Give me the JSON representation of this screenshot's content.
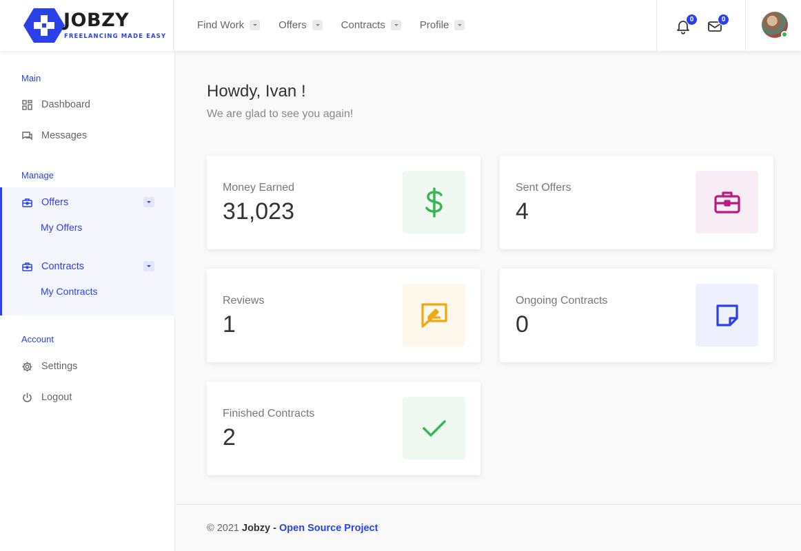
{
  "brand": {
    "name": "JOBZY",
    "tagline": "FREELANCING MADE EASY",
    "accent": "#2a41e8"
  },
  "nav": [
    {
      "label": "Find Work"
    },
    {
      "label": "Offers"
    },
    {
      "label": "Contracts"
    },
    {
      "label": "Profile"
    }
  ],
  "header": {
    "notifications_count": "0",
    "messages_count": "0"
  },
  "sidebar": {
    "main_title": "Main",
    "dashboard": "Dashboard",
    "messages": "Messages",
    "manage_title": "Manage",
    "offers": "Offers",
    "my_offers": "My Offers",
    "contracts": "Contracts",
    "my_contracts": "My Contracts",
    "account_title": "Account",
    "settings": "Settings",
    "logout": "Logout"
  },
  "main": {
    "greeting": "Howdy, Ivan !",
    "subtitle": "We are glad to see you again!",
    "cards": [
      {
        "label": "Money Earned",
        "value": "31,023",
        "icon": "dollar-icon",
        "color": "#38b653",
        "bg": "#eff8f1"
      },
      {
        "label": "Sent Offers",
        "value": "4",
        "icon": "briefcase-icon",
        "color": "#b81b7f",
        "bg": "#f8edf5"
      },
      {
        "label": "Reviews",
        "value": "1",
        "icon": "review-icon",
        "color": "#efa80f",
        "bg": "#fdf7ec"
      },
      {
        "label": "Ongoing Contracts",
        "value": "0",
        "icon": "note-icon",
        "color": "#2a41e8",
        "bg": "#eef0fd"
      },
      {
        "label": "Finished Contracts",
        "value": "2",
        "icon": "checkmark-icon",
        "color": "#38b653",
        "bg": "#eff8f1"
      }
    ]
  },
  "footer": {
    "copyright": "© 2021",
    "brand": "Jobzy",
    "separator": "-",
    "link": "Open Source Project"
  }
}
